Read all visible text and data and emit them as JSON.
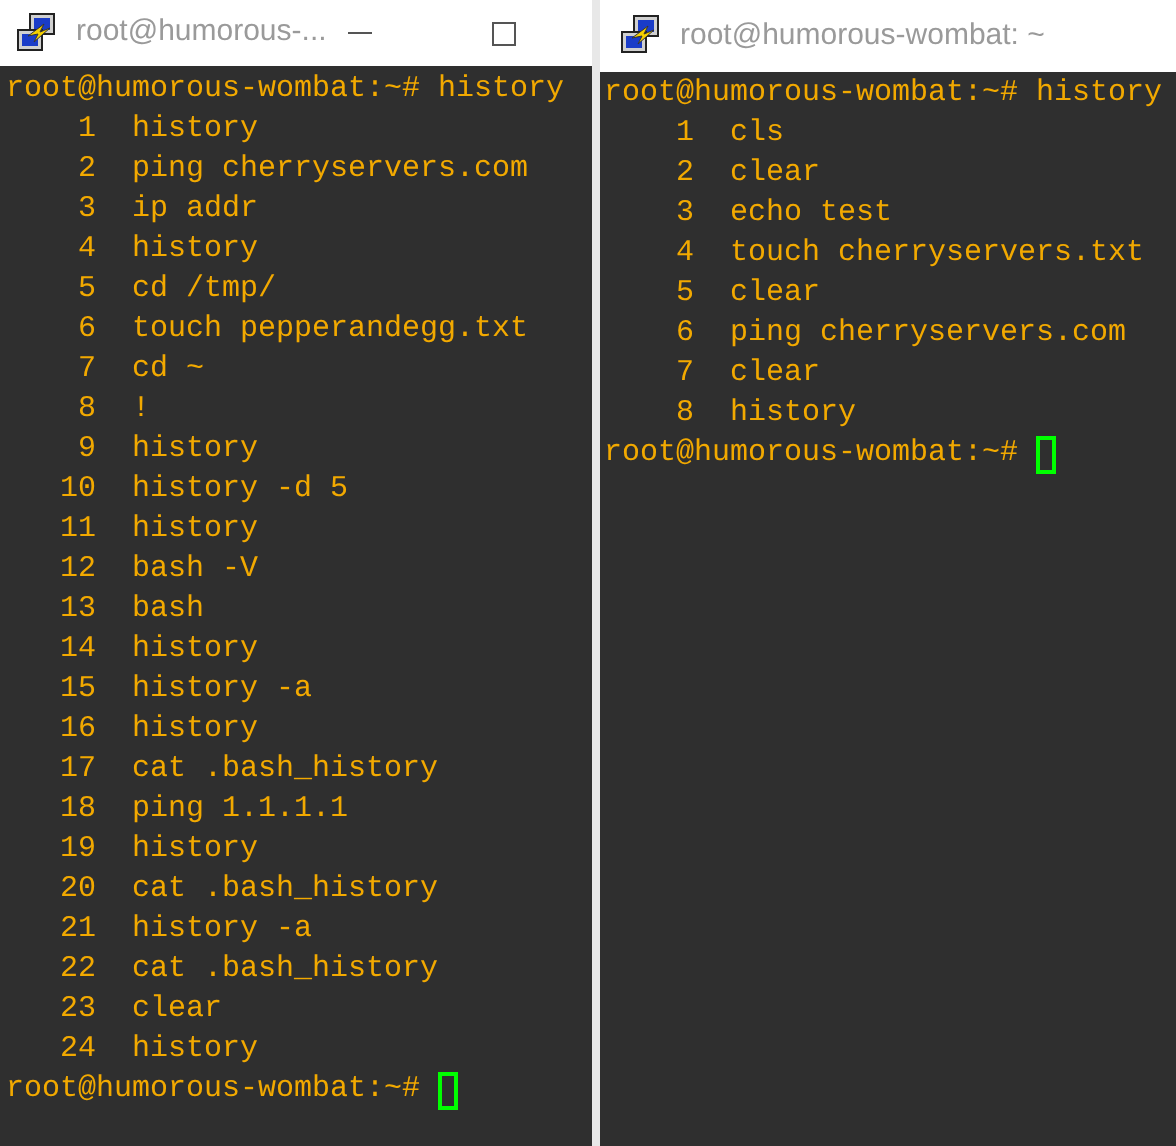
{
  "windows": [
    {
      "title": "root@humorous-...",
      "window_buttons": true,
      "command_line": "root@humorous-wombat:~# history",
      "entries": [
        {
          "number": "1",
          "command": "history"
        },
        {
          "number": "2",
          "command": "ping cherryservers.com"
        },
        {
          "number": "3",
          "command": "ip addr"
        },
        {
          "number": "4",
          "command": "history"
        },
        {
          "number": "5",
          "command": "cd /tmp/"
        },
        {
          "number": "6",
          "command": "touch pepperandegg.txt"
        },
        {
          "number": "7",
          "command": "cd ~"
        },
        {
          "number": "8",
          "command": "!"
        },
        {
          "number": "9",
          "command": "history"
        },
        {
          "number": "10",
          "command": "history -d 5"
        },
        {
          "number": "11",
          "command": "history"
        },
        {
          "number": "12",
          "command": "bash -V"
        },
        {
          "number": "13",
          "command": "bash"
        },
        {
          "number": "14",
          "command": "history"
        },
        {
          "number": "15",
          "command": "history -a"
        },
        {
          "number": "16",
          "command": "history"
        },
        {
          "number": "17",
          "command": "cat .bash_history"
        },
        {
          "number": "18",
          "command": "ping 1.1.1.1"
        },
        {
          "number": "19",
          "command": "history"
        },
        {
          "number": "20",
          "command": "cat .bash_history"
        },
        {
          "number": "21",
          "command": "history -a"
        },
        {
          "number": "22",
          "command": "cat .bash_history"
        },
        {
          "number": "23",
          "command": "clear"
        },
        {
          "number": "24",
          "command": "history"
        }
      ],
      "prompt": "root@humorous-wombat:~#"
    },
    {
      "title": "root@humorous-wombat: ~",
      "window_buttons": false,
      "command_line": "root@humorous-wombat:~# history",
      "entries": [
        {
          "number": "1",
          "command": "cls"
        },
        {
          "number": "2",
          "command": "clear"
        },
        {
          "number": "3",
          "command": "echo test"
        },
        {
          "number": "4",
          "command": "touch cherryservers.txt"
        },
        {
          "number": "5",
          "command": "clear"
        },
        {
          "number": "6",
          "command": "ping cherryservers.com"
        },
        {
          "number": "7",
          "command": "clear"
        },
        {
          "number": "8",
          "command": "history"
        }
      ],
      "prompt": "root@humorous-wombat:~#"
    }
  ]
}
